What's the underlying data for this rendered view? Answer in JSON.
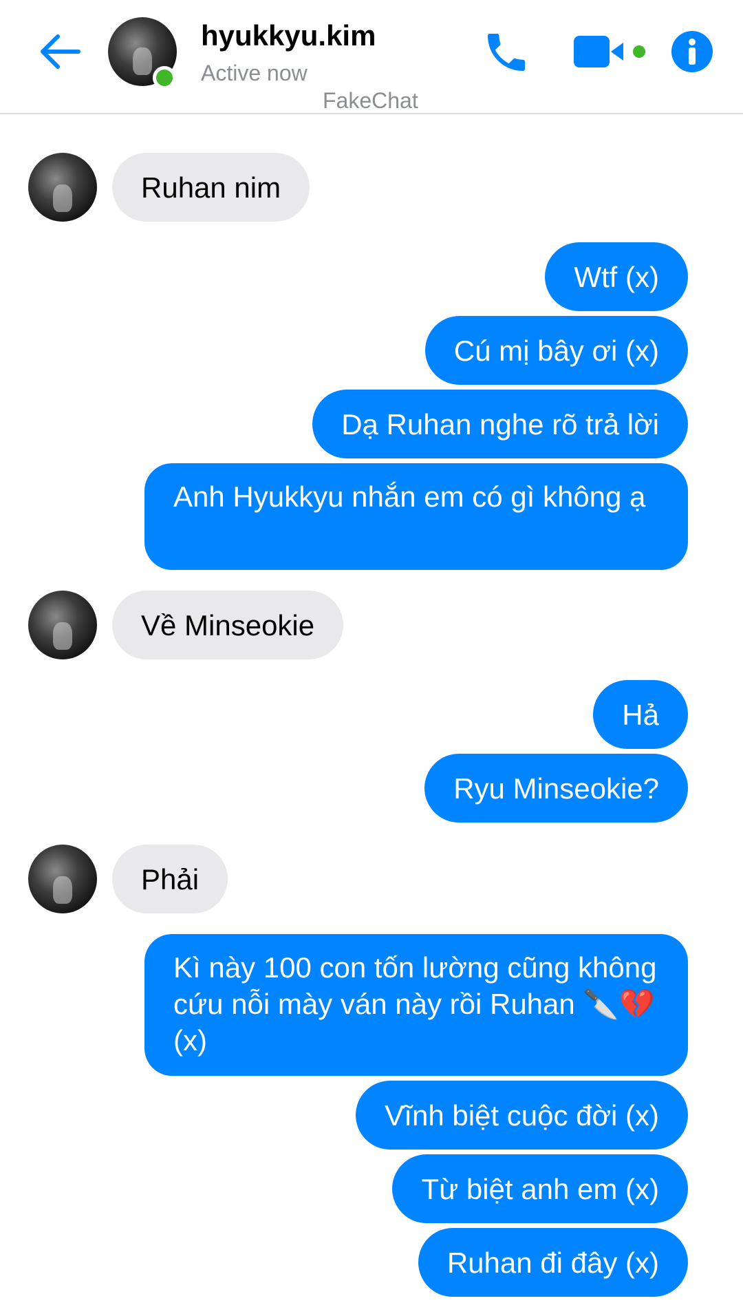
{
  "header": {
    "contact_name": "hyukkyu.kim",
    "status": "Active now",
    "watermark": "FakeChat",
    "icons": {
      "back": "arrow-left-icon",
      "call": "phone-icon",
      "video": "video-camera-icon",
      "info": "info-icon"
    }
  },
  "colors": {
    "accent": "#0084ff",
    "incoming_bubble": "#e9e9eb",
    "online": "#42b72a",
    "secondary_text": "#8a8d91"
  },
  "messages": [
    {
      "from": "contact",
      "text": "Ruhan nim"
    },
    {
      "from": "me",
      "text": "Wtf (x)"
    },
    {
      "from": "me",
      "text": "Cú mị bây ơi (x)"
    },
    {
      "from": "me",
      "text": "Dạ Ruhan nghe rõ trả lời"
    },
    {
      "from": "me",
      "text": "Anh Hyukkyu nhắn em có gì không ạ"
    },
    {
      "from": "contact",
      "text": "Về Minseokie"
    },
    {
      "from": "me",
      "text": "Hả"
    },
    {
      "from": "me",
      "text": "Ryu Minseokie?"
    },
    {
      "from": "contact",
      "text": "Phải"
    },
    {
      "from": "me",
      "text": "Kì này 100 con tốn lường cũng không cứu nỗi mày ván này rồi Ruhan 🔪💔 (x)"
    },
    {
      "from": "me",
      "text": "Vĩnh biệt cuộc đời (x)"
    },
    {
      "from": "me",
      "text": "Từ biệt anh em (x)"
    },
    {
      "from": "me",
      "text": "Ruhan đi đây (x)"
    }
  ]
}
